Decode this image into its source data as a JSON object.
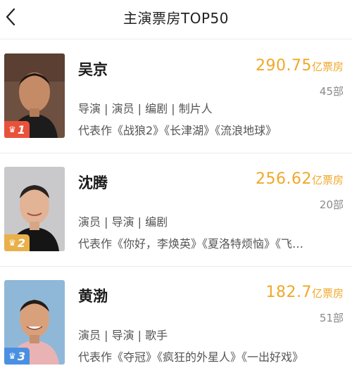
{
  "header": {
    "title": "主演票房TOP50"
  },
  "icons": {
    "back": "chevron-left-icon",
    "crown": "crown-icon"
  },
  "colors": {
    "accent": "#f0a82a",
    "rank1": "#e8523a",
    "rank2": "#e9b04a",
    "rank3": "#4a90e2"
  },
  "actors": [
    {
      "rank": "1",
      "name": "吴京",
      "box_office": "290.75",
      "box_office_unit": "亿票房",
      "movie_count": "45部",
      "roles": "导演 | 演员 | 编剧 | 制片人",
      "works": "代表作《战狼2》《长津湖》《流浪地球》"
    },
    {
      "rank": "2",
      "name": "沈腾",
      "box_office": "256.62",
      "box_office_unit": "亿票房",
      "movie_count": "20部",
      "roles": "演员 | 导演 | 编剧",
      "works": "代表作《你好，李焕英》《夏洛特烦恼》《飞…"
    },
    {
      "rank": "3",
      "name": "黄渤",
      "box_office": "182.7",
      "box_office_unit": "亿票房",
      "movie_count": "51部",
      "roles": "演员 | 导演 | 歌手",
      "works": "代表作《夺冠》《疯狂的外星人》《一出好戏》"
    }
  ]
}
